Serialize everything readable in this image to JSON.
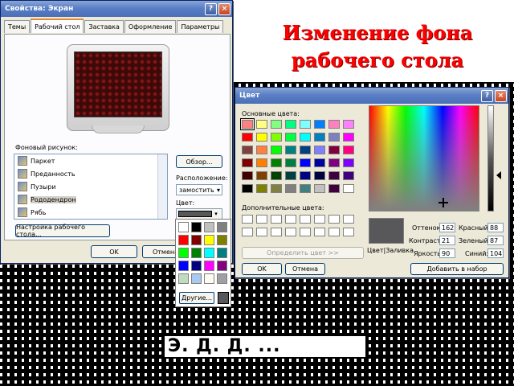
{
  "slide": {
    "title_line1": "Изменение фона",
    "title_line2": "рабочего стола",
    "footer_text": "Э. Д. Д. ... ",
    "page_number": ""
  },
  "display_dialog": {
    "title": "Свойства: Экран",
    "help_label": "?",
    "close_label": "×",
    "tabs": [
      "Темы",
      "Рабочий стол",
      "Заставка",
      "Оформление",
      "Параметры"
    ],
    "active_tab": "Рабочий стол",
    "background_label": "Фоновый рисунок:",
    "wallpapers": [
      "Паркет",
      "Преданность",
      "Пузыри",
      "Рододендрон",
      "Рябь"
    ],
    "selected_wallpaper": "Рододендрон",
    "browse_button": "Обзор...",
    "position_label": "Расположение:",
    "position_value": "замостить",
    "color_label": "Цвет:",
    "customize_button": "Настройка рабочего стола...",
    "ok_button": "OK",
    "cancel_button": "Отмена",
    "dropdown_arrow": "▾"
  },
  "color_popup": {
    "colors": [
      "#ffffff",
      "#000000",
      "#c0c0c0",
      "#808080",
      "#ff0000",
      "#800000",
      "#ffff00",
      "#808000",
      "#00ff00",
      "#008000",
      "#00ffff",
      "#008080",
      "#0000ff",
      "#000080",
      "#ff00ff",
      "#800080",
      "#c0dcc0",
      "#a6caf0",
      "#fffbf0",
      "#a0a0a4"
    ],
    "other_button": "Другие...",
    "current_color": "#58585a"
  },
  "color_dialog": {
    "title": "Цвет",
    "help_label": "?",
    "close_label": "×",
    "basic_label": "Основные цвета:",
    "basic_colors": [
      "#ff8080",
      "#ffff80",
      "#80ff80",
      "#00ff80",
      "#80ffff",
      "#0080ff",
      "#ff80c0",
      "#ff80ff",
      "#ff0000",
      "#ffff00",
      "#80ff00",
      "#00ff40",
      "#00ffff",
      "#0080c0",
      "#8080c0",
      "#ff00ff",
      "#804040",
      "#ff8040",
      "#00ff00",
      "#008080",
      "#004080",
      "#8080ff",
      "#800040",
      "#ff0080",
      "#800000",
      "#ff8000",
      "#008000",
      "#008040",
      "#0000ff",
      "#0000a0",
      "#800080",
      "#8000ff",
      "#400000",
      "#804000",
      "#004000",
      "#004040",
      "#000080",
      "#000040",
      "#400040",
      "#400080",
      "#000000",
      "#808000",
      "#808040",
      "#808080",
      "#408080",
      "#c0c0c0",
      "#400040",
      "#ffffff"
    ],
    "selected_basic_index": 0,
    "custom_label": "Дополнительные цвета:",
    "custom_count": 16,
    "define_button": "Определить цвет >>",
    "ok_button": "OK",
    "cancel_button": "Отмена",
    "preview_label": "Цвет|Заливка",
    "hue_label": "Оттенок:",
    "hue": "162",
    "sat_label": "Контраст:",
    "sat": "21",
    "lum_label": "Яркость:",
    "lum": "90",
    "red_label": "Красный:",
    "red": "88",
    "green_label": "Зеленый:",
    "green": "87",
    "blue_label": "Синий:",
    "blue": "104",
    "add_button": "Добавить в набор"
  }
}
